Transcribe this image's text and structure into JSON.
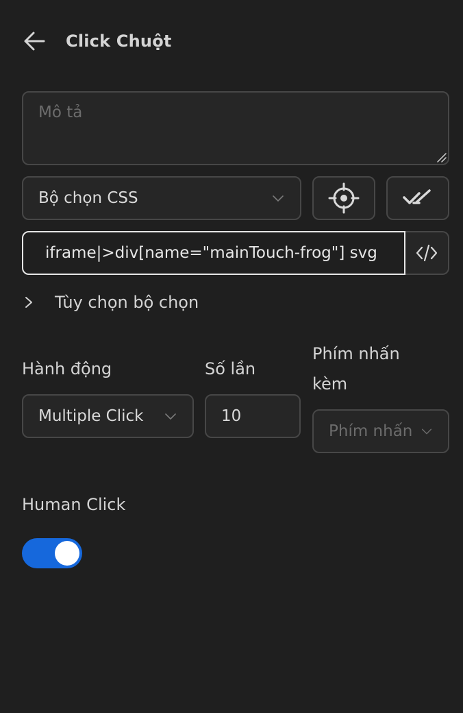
{
  "header": {
    "title": "Click Chuột",
    "back_icon": "arrow-left-icon"
  },
  "description": {
    "placeholder": "Mô tả",
    "value": ""
  },
  "selector_type": {
    "value": "Bộ chọn CSS",
    "icon": "chevron-down-icon"
  },
  "buttons": {
    "pick_element_icon": "crosshair-icon",
    "validate_icon": "double-check-icon",
    "code_icon": "code-icon"
  },
  "selector": {
    "value": "iframe|>div[name=\"mainTouch-frog\"] svg"
  },
  "selector_options": {
    "label": "Tùy chọn bộ chọn",
    "expanded": false
  },
  "action": {
    "label": "Hành động",
    "value": "Multiple Click"
  },
  "count": {
    "label": "Số lần",
    "value": "10"
  },
  "modifier": {
    "label_line1": "Phím nhấn",
    "label_line2": "kèm",
    "placeholder": "Phím nhấn"
  },
  "human_click": {
    "label": "Human Click",
    "enabled": true
  },
  "colors": {
    "background": "#1f1f1f",
    "toggle_on": "#1668dc",
    "border": "#474747",
    "focused_border": "#e6e6e6"
  }
}
